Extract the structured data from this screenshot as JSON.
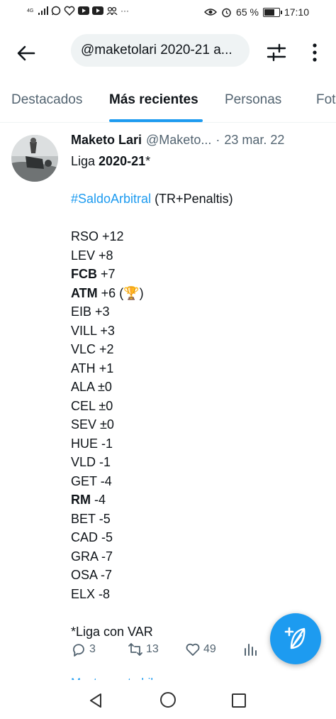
{
  "statusbar": {
    "network": "4G",
    "battery_percent": "65 %",
    "battery_level": 0.65,
    "time": "17:10"
  },
  "topbar": {
    "search_value": "@maketolari 2020-21 a..."
  },
  "tabs": [
    {
      "label": "Destacados",
      "active": false
    },
    {
      "label": "Más recientes",
      "active": true
    },
    {
      "label": "Personas",
      "active": false
    },
    {
      "label": "Fot",
      "active": false
    }
  ],
  "tweet": {
    "name": "Maketo Lari",
    "handle": "@Maketo...",
    "separator": "·",
    "date": "23 mar. 22",
    "line1_prefix": "Liga ",
    "line1_bold": "2020-21",
    "line1_suffix": "*",
    "hashtag": "#SaldoArbitral",
    "hashtag_rest": " (TR+Penaltis)",
    "rows": [
      {
        "team": "RSO",
        "value": "+12",
        "bold": false
      },
      {
        "team": "LEV",
        "value": "+8",
        "bold": false
      },
      {
        "team": "FCB",
        "value": "+7",
        "bold": true
      },
      {
        "team": "ATM",
        "value": "+6 (🏆)",
        "bold": true
      },
      {
        "team": "EIB",
        "value": "+3",
        "bold": false
      },
      {
        "team": "VILL",
        "value": "+3",
        "bold": false
      },
      {
        "team": "VLC",
        "value": "+2",
        "bold": false
      },
      {
        "team": "ATH",
        "value": "+1",
        "bold": false
      },
      {
        "team": "ALA",
        "value": "±0",
        "bold": false
      },
      {
        "team": "CEL",
        "value": "±0",
        "bold": false
      },
      {
        "team": "SEV",
        "value": "±0",
        "bold": false
      },
      {
        "team": "HUE",
        "value": "-1",
        "bold": false
      },
      {
        "team": "VLD",
        "value": "-1",
        "bold": false
      },
      {
        "team": "GET",
        "value": "-4",
        "bold": false
      },
      {
        "team": "RM",
        "value": "-4",
        "bold": true
      },
      {
        "team": "BET",
        "value": "-5",
        "bold": false
      },
      {
        "team": "CAD",
        "value": "-5",
        "bold": false
      },
      {
        "team": "GRA",
        "value": "-7",
        "bold": false
      },
      {
        "team": "OSA",
        "value": "-7",
        "bold": false
      },
      {
        "team": "ELX",
        "value": "-8",
        "bold": false
      }
    ],
    "footnote": "*Liga con VAR"
  },
  "actions": {
    "replies": "3",
    "retweets": "13",
    "likes": "49"
  },
  "show_thread": "Mostrar este hilo",
  "colors": {
    "accent": "#1d9bf0",
    "secondary_text": "#536471",
    "primary_text": "#0f1419"
  }
}
